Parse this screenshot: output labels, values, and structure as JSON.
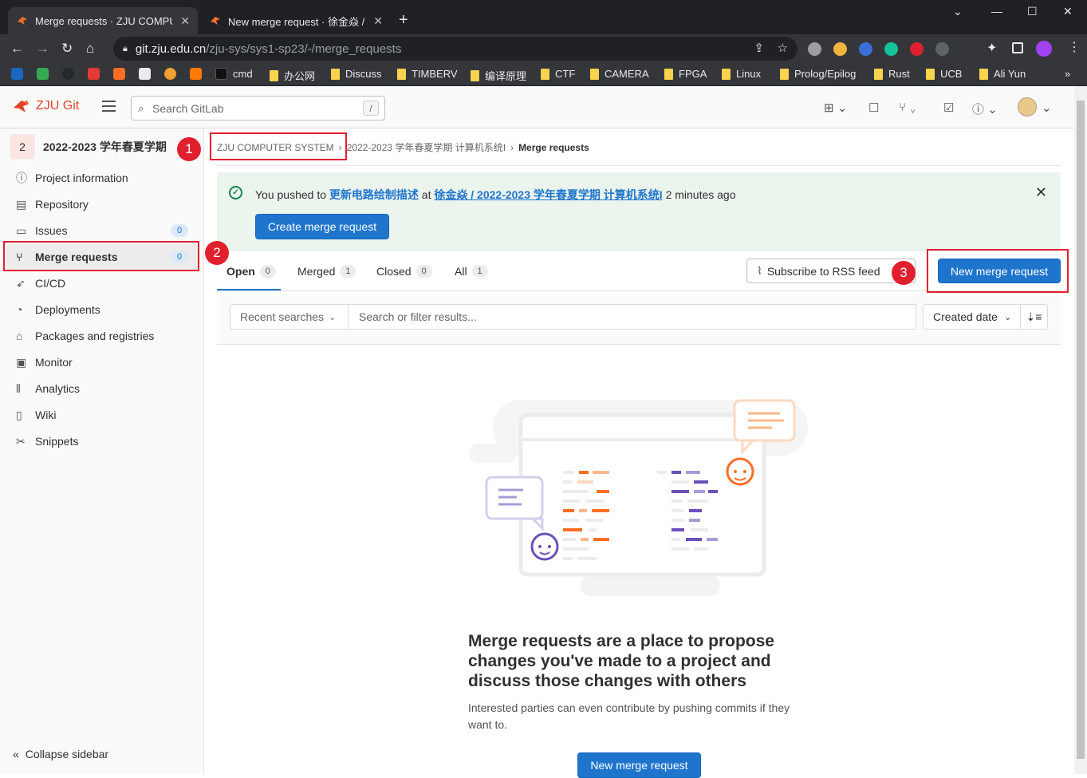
{
  "browser": {
    "tabs": [
      {
        "title": "Merge requests · ZJU COMPUT"
      },
      {
        "title": "New merge request · 徐金焱 / ..."
      }
    ],
    "url_host": "git.zju.edu.cn",
    "url_path": "/zju-sys/sys1-sp23/-/merge_requests",
    "bookmarks": [
      "cmd",
      "办公网",
      "Discuss",
      "TIMBERV",
      "编译原理",
      "CTF",
      "CAMERA",
      "FPGA",
      "Linux",
      "Prolog/Epilog",
      "Rust",
      "UCB",
      "Ali Yun"
    ],
    "bookmarks_more": "»"
  },
  "header": {
    "brand": "ZJU Git",
    "search_placeholder": "Search GitLab",
    "search_shortcut": "/"
  },
  "sidebar": {
    "project_avatar": "2",
    "project_name": "2022-2023 学年春夏学期",
    "items": [
      {
        "label": "Project information",
        "icon": "info-icon"
      },
      {
        "label": "Repository",
        "icon": "doc-icon"
      },
      {
        "label": "Issues",
        "icon": "issues-icon",
        "count": "0"
      },
      {
        "label": "Merge requests",
        "icon": "merge-request-icon",
        "count": "0"
      },
      {
        "label": "CI/CD",
        "icon": "rocket-icon"
      },
      {
        "label": "Deployments",
        "icon": "deployments-icon"
      },
      {
        "label": "Packages and registries",
        "icon": "package-icon"
      },
      {
        "label": "Monitor",
        "icon": "monitor-icon"
      },
      {
        "label": "Analytics",
        "icon": "chart-icon"
      },
      {
        "label": "Wiki",
        "icon": "book-icon"
      },
      {
        "label": "Snippets",
        "icon": "scissors-icon"
      }
    ],
    "collapse": "Collapse sidebar"
  },
  "breadcrumb": {
    "group": "ZJU COMPUTER SYSTEM",
    "project": "2022-2023 学年春夏学期 计算机系统I",
    "current": "Merge requests"
  },
  "alert": {
    "prefix": "You pushed to",
    "branch": "更新电路绘制描述",
    "at": "at",
    "project_link": "徐金焱 / 2022-2023 学年春夏学期 计算机系统I",
    "time": "2 minutes ago",
    "button": "Create merge request"
  },
  "tabs": [
    {
      "label": "Open",
      "count": "0"
    },
    {
      "label": "Merged",
      "count": "1"
    },
    {
      "label": "Closed",
      "count": "0"
    },
    {
      "label": "All",
      "count": "1"
    }
  ],
  "actions": {
    "rss": "Subscribe to RSS feed",
    "new_mr": "New merge request"
  },
  "filter": {
    "recent": "Recent searches",
    "placeholder": "Search or filter results...",
    "sort": "Created date"
  },
  "empty": {
    "title": "Merge requests are a place to propose changes you've made to a project and discuss those changes with others",
    "description": "Interested parties can even contribute by pushing commits if they want to.",
    "button": "New merge request"
  },
  "annotations": [
    "1",
    "2",
    "3"
  ],
  "colors": {
    "annotation": "#e0202e",
    "primary": "#1f75cb",
    "alert_bg": "#ecf4ee"
  }
}
